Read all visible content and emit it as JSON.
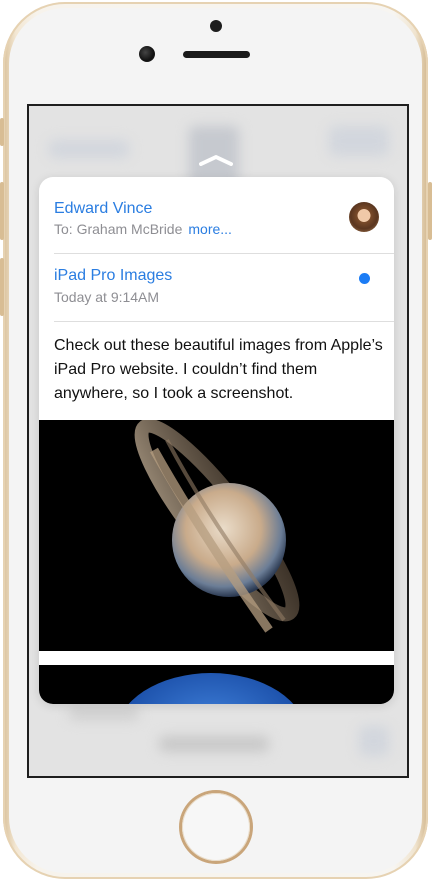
{
  "email": {
    "sender": "Edward Vince",
    "to_line": "To: Graham McBride",
    "more_label": "more...",
    "subject": "iPad Pro Images",
    "timestamp": "Today at 9:14AM",
    "body": "Check out these beautiful images from Apple’s iPad Pro website. I couldn’t find them anywhere, so I took a screenshot."
  },
  "icons": {
    "chevron": "chevron-up-icon",
    "unread": "unread-dot-icon"
  },
  "colors": {
    "accent": "#2a7de1",
    "unread_dot": "#1b7cf5",
    "secondary_text": "#8e8e93",
    "phone_frame": "#d9c09a"
  }
}
